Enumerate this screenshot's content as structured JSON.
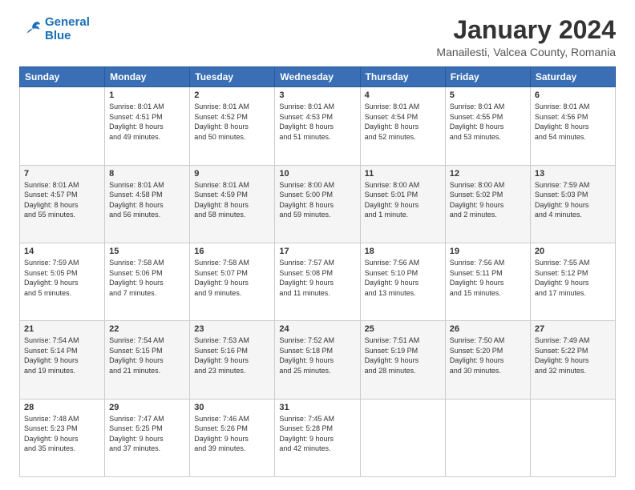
{
  "logo": {
    "line1": "General",
    "line2": "Blue"
  },
  "title": "January 2024",
  "location": "Manailesti, Valcea County, Romania",
  "days_header": [
    "Sunday",
    "Monday",
    "Tuesday",
    "Wednesday",
    "Thursday",
    "Friday",
    "Saturday"
  ],
  "weeks": [
    [
      {
        "num": "",
        "info": ""
      },
      {
        "num": "1",
        "info": "Sunrise: 8:01 AM\nSunset: 4:51 PM\nDaylight: 8 hours\nand 49 minutes."
      },
      {
        "num": "2",
        "info": "Sunrise: 8:01 AM\nSunset: 4:52 PM\nDaylight: 8 hours\nand 50 minutes."
      },
      {
        "num": "3",
        "info": "Sunrise: 8:01 AM\nSunset: 4:53 PM\nDaylight: 8 hours\nand 51 minutes."
      },
      {
        "num": "4",
        "info": "Sunrise: 8:01 AM\nSunset: 4:54 PM\nDaylight: 8 hours\nand 52 minutes."
      },
      {
        "num": "5",
        "info": "Sunrise: 8:01 AM\nSunset: 4:55 PM\nDaylight: 8 hours\nand 53 minutes."
      },
      {
        "num": "6",
        "info": "Sunrise: 8:01 AM\nSunset: 4:56 PM\nDaylight: 8 hours\nand 54 minutes."
      }
    ],
    [
      {
        "num": "7",
        "info": "Sunrise: 8:01 AM\nSunset: 4:57 PM\nDaylight: 8 hours\nand 55 minutes."
      },
      {
        "num": "8",
        "info": "Sunrise: 8:01 AM\nSunset: 4:58 PM\nDaylight: 8 hours\nand 56 minutes."
      },
      {
        "num": "9",
        "info": "Sunrise: 8:01 AM\nSunset: 4:59 PM\nDaylight: 8 hours\nand 58 minutes."
      },
      {
        "num": "10",
        "info": "Sunrise: 8:00 AM\nSunset: 5:00 PM\nDaylight: 8 hours\nand 59 minutes."
      },
      {
        "num": "11",
        "info": "Sunrise: 8:00 AM\nSunset: 5:01 PM\nDaylight: 9 hours\nand 1 minute."
      },
      {
        "num": "12",
        "info": "Sunrise: 8:00 AM\nSunset: 5:02 PM\nDaylight: 9 hours\nand 2 minutes."
      },
      {
        "num": "13",
        "info": "Sunrise: 7:59 AM\nSunset: 5:03 PM\nDaylight: 9 hours\nand 4 minutes."
      }
    ],
    [
      {
        "num": "14",
        "info": "Sunrise: 7:59 AM\nSunset: 5:05 PM\nDaylight: 9 hours\nand 5 minutes."
      },
      {
        "num": "15",
        "info": "Sunrise: 7:58 AM\nSunset: 5:06 PM\nDaylight: 9 hours\nand 7 minutes."
      },
      {
        "num": "16",
        "info": "Sunrise: 7:58 AM\nSunset: 5:07 PM\nDaylight: 9 hours\nand 9 minutes."
      },
      {
        "num": "17",
        "info": "Sunrise: 7:57 AM\nSunset: 5:08 PM\nDaylight: 9 hours\nand 11 minutes."
      },
      {
        "num": "18",
        "info": "Sunrise: 7:56 AM\nSunset: 5:10 PM\nDaylight: 9 hours\nand 13 minutes."
      },
      {
        "num": "19",
        "info": "Sunrise: 7:56 AM\nSunset: 5:11 PM\nDaylight: 9 hours\nand 15 minutes."
      },
      {
        "num": "20",
        "info": "Sunrise: 7:55 AM\nSunset: 5:12 PM\nDaylight: 9 hours\nand 17 minutes."
      }
    ],
    [
      {
        "num": "21",
        "info": "Sunrise: 7:54 AM\nSunset: 5:14 PM\nDaylight: 9 hours\nand 19 minutes."
      },
      {
        "num": "22",
        "info": "Sunrise: 7:54 AM\nSunset: 5:15 PM\nDaylight: 9 hours\nand 21 minutes."
      },
      {
        "num": "23",
        "info": "Sunrise: 7:53 AM\nSunset: 5:16 PM\nDaylight: 9 hours\nand 23 minutes."
      },
      {
        "num": "24",
        "info": "Sunrise: 7:52 AM\nSunset: 5:18 PM\nDaylight: 9 hours\nand 25 minutes."
      },
      {
        "num": "25",
        "info": "Sunrise: 7:51 AM\nSunset: 5:19 PM\nDaylight: 9 hours\nand 28 minutes."
      },
      {
        "num": "26",
        "info": "Sunrise: 7:50 AM\nSunset: 5:20 PM\nDaylight: 9 hours\nand 30 minutes."
      },
      {
        "num": "27",
        "info": "Sunrise: 7:49 AM\nSunset: 5:22 PM\nDaylight: 9 hours\nand 32 minutes."
      }
    ],
    [
      {
        "num": "28",
        "info": "Sunrise: 7:48 AM\nSunset: 5:23 PM\nDaylight: 9 hours\nand 35 minutes."
      },
      {
        "num": "29",
        "info": "Sunrise: 7:47 AM\nSunset: 5:25 PM\nDaylight: 9 hours\nand 37 minutes."
      },
      {
        "num": "30",
        "info": "Sunrise: 7:46 AM\nSunset: 5:26 PM\nDaylight: 9 hours\nand 39 minutes."
      },
      {
        "num": "31",
        "info": "Sunrise: 7:45 AM\nSunset: 5:28 PM\nDaylight: 9 hours\nand 42 minutes."
      },
      {
        "num": "",
        "info": ""
      },
      {
        "num": "",
        "info": ""
      },
      {
        "num": "",
        "info": ""
      }
    ]
  ]
}
